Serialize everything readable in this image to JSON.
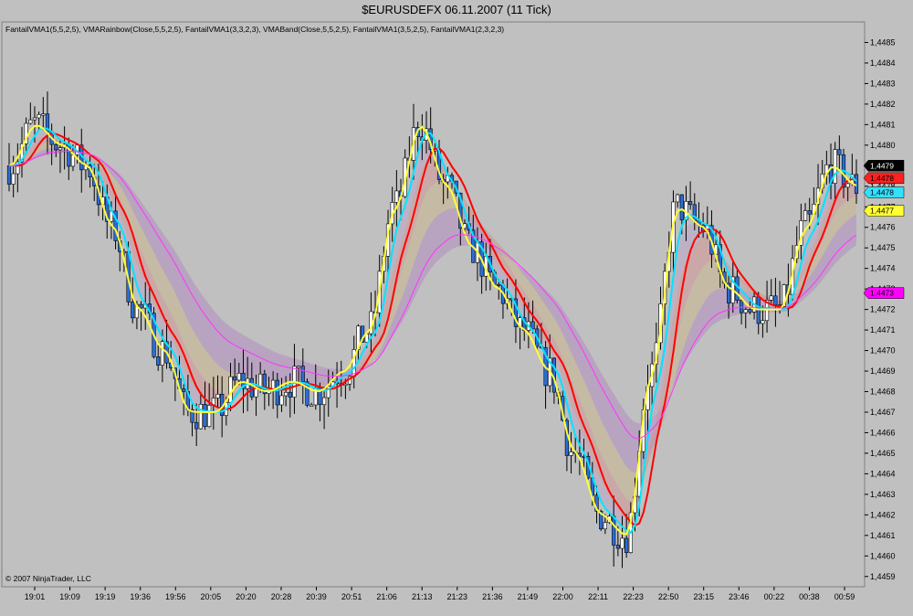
{
  "window": {
    "title": "$EURUSDEFX  06.11.2007  (11 Tick)"
  },
  "indicators_label": "FantailVMA1(5,5,2,5), VMARainbow(Close,5,5,2,5), FantailVMA1(3,3,2,3), VMABand(Close,5,5,2,5), FantailVMA1(3,5,2,5), FantailVMA1(2,3,2,3)",
  "copyright": "© 2007 NinjaTrader, LLC",
  "chart_data": {
    "type": "candlestick",
    "ylim": [
      1.44585,
      1.4486
    ],
    "y_ticks": [
      "1,4459",
      "1,4460",
      "1,4461",
      "1,4462",
      "1,4463",
      "1,4464",
      "1,4465",
      "1,4466",
      "1,4467",
      "1,4468",
      "1,4469",
      "1,4470",
      "1,4471",
      "1,4472",
      "1,4473",
      "1,4474",
      "1,4475",
      "1,4476",
      "1,4477",
      "1,4478",
      "1,4479",
      "1,4480",
      "1,4481",
      "1,4482",
      "1,4483",
      "1,4484",
      "1,4485"
    ],
    "x_ticks": [
      "19:01",
      "19:09",
      "19:19",
      "19:36",
      "19:56",
      "20:05",
      "20:20",
      "20:28",
      "20:39",
      "20:51",
      "21:06",
      "21:13",
      "21:23",
      "21:36",
      "21:49",
      "22:00",
      "22:11",
      "22:23",
      "22:50",
      "23:15",
      "23:46",
      "00:22",
      "00:38",
      "00:59"
    ],
    "price_path": [
      1.4479,
      1.4481,
      1.448,
      1.4479,
      1.4476,
      1.4472,
      1.447,
      1.4467,
      1.4467,
      1.44685,
      1.4468,
      1.44685,
      1.4468,
      1.4469,
      1.4471,
      1.4477,
      1.4481,
      1.4478,
      1.4475,
      1.4473,
      1.4471,
      1.4469,
      1.4465,
      1.4462,
      1.4461,
      1.4469,
      1.4477,
      1.4476,
      1.4473,
      1.4472,
      1.4472,
      1.4476,
      1.4479,
      1.4478
    ],
    "ribbon_colors": [
      "#b08cc0",
      "#c8b48c",
      "#d49494",
      "#b9a5c9"
    ],
    "series": [
      {
        "color": "#ff0000",
        "smoothing": 0.28,
        "lag": 2
      },
      {
        "color": "#00e5ff",
        "smoothing": 0.5,
        "lag": 1
      },
      {
        "color": "#ffff33",
        "smoothing": 0.75,
        "lag": 0
      },
      {
        "color": "#ff33ff",
        "smoothing": 0.06,
        "lag": 0
      }
    ],
    "price_tags": [
      {
        "value": "1,4479",
        "price": 1.4479,
        "bg": "#000000",
        "fg": "#ffffff"
      },
      {
        "value": "1,4478",
        "price": 1.44784,
        "bg": "#ff2020",
        "fg": "#000000"
      },
      {
        "value": "1,4478",
        "price": 1.44777,
        "bg": "#33e0ff",
        "fg": "#000000"
      },
      {
        "value": "1,4477",
        "price": 1.44768,
        "bg": "#ffff33",
        "fg": "#000000"
      },
      {
        "value": "1,4473",
        "price": 1.44728,
        "bg": "#ff00ff",
        "fg": "#000000"
      }
    ]
  }
}
